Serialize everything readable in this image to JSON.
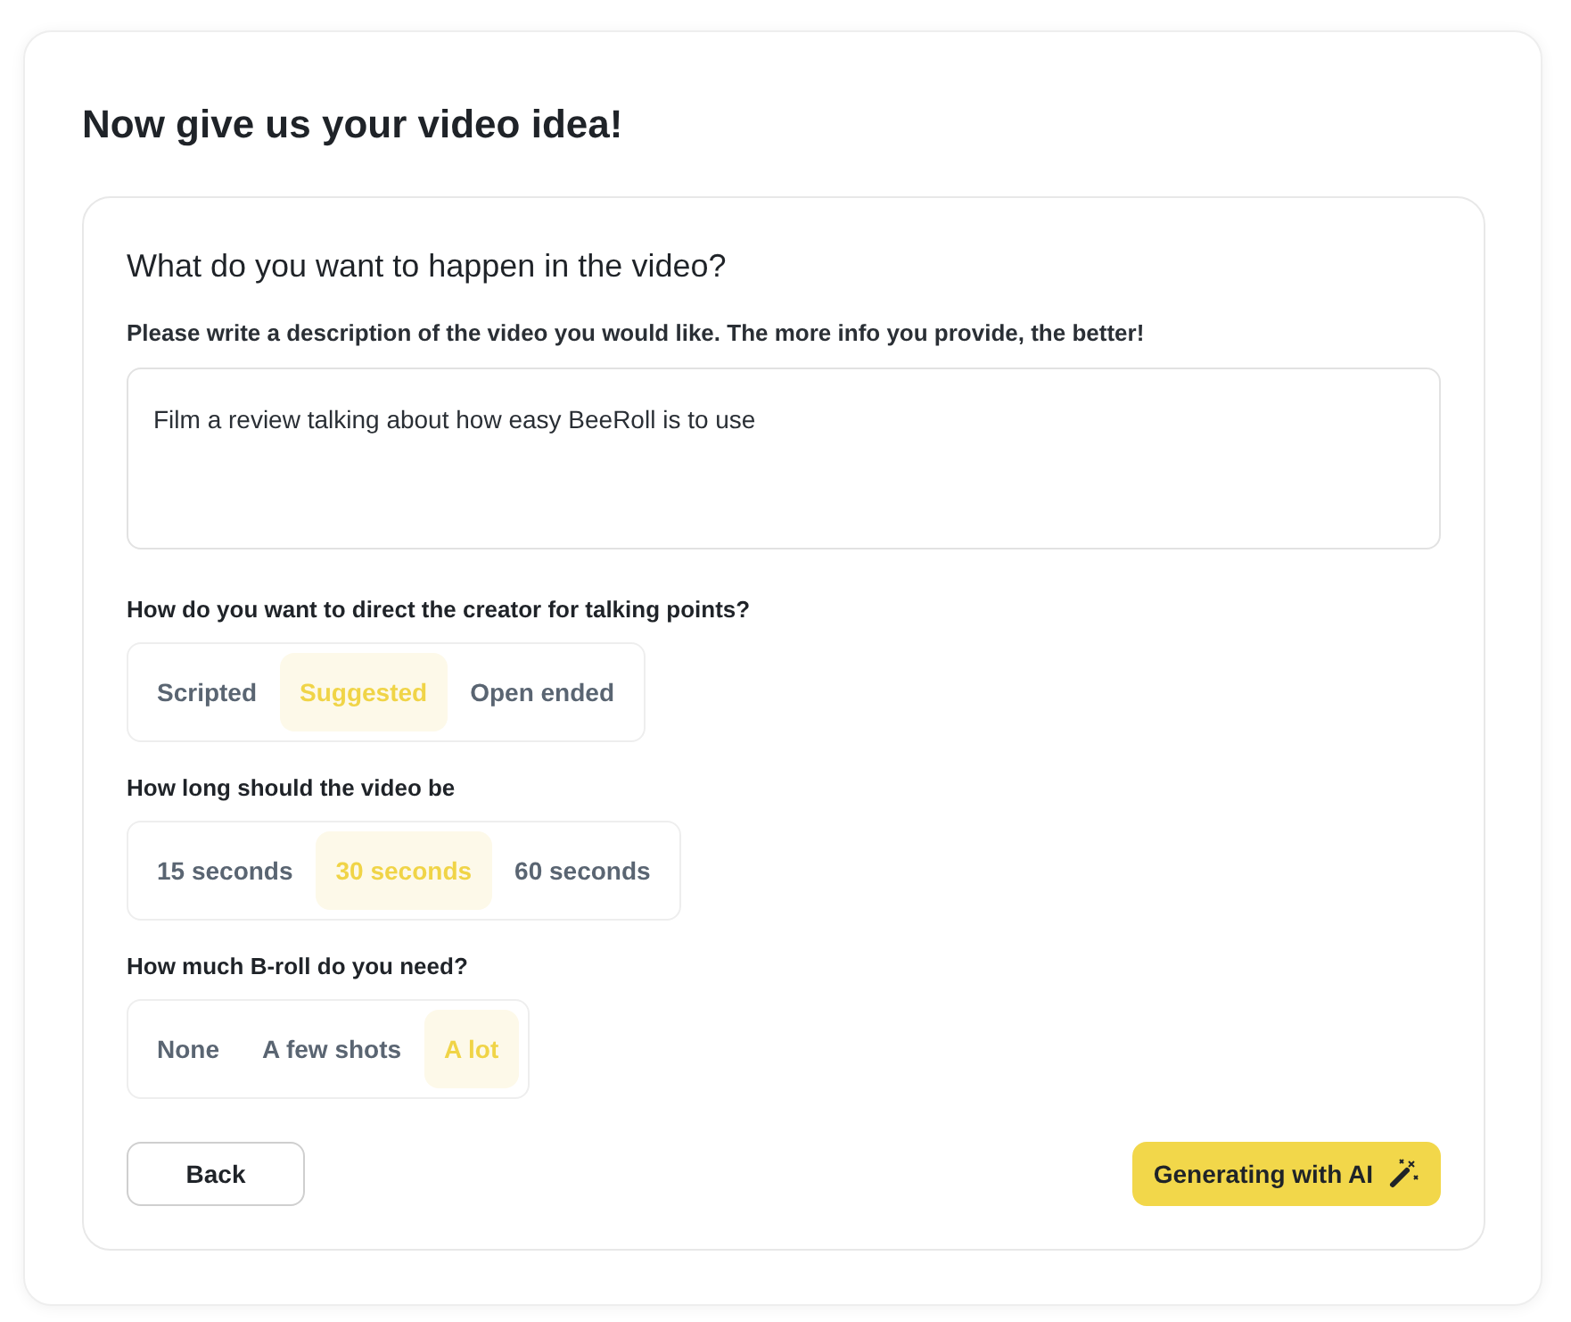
{
  "title": "Now give us your video idea!",
  "section": {
    "heading": "What do you want to happen in the video?",
    "description_label": "Please write a description of the video you would like. The more info you provide, the better!",
    "description_value": "Film a review talking about how easy BeeRoll is to use",
    "questions": [
      {
        "label": "How do you want to direct the creator for talking points?",
        "options": [
          {
            "label": "Scripted",
            "selected": false
          },
          {
            "label": "Suggested",
            "selected": true
          },
          {
            "label": "Open ended",
            "selected": false
          }
        ]
      },
      {
        "label": "How long should the video be",
        "options": [
          {
            "label": "15 seconds",
            "selected": false
          },
          {
            "label": "30 seconds",
            "selected": true
          },
          {
            "label": "60 seconds",
            "selected": false
          }
        ]
      },
      {
        "label": "How much B-roll do you need?",
        "options": [
          {
            "label": "None",
            "selected": false
          },
          {
            "label": "A few shots",
            "selected": false
          },
          {
            "label": "A lot",
            "selected": true
          }
        ]
      }
    ],
    "back_button": "Back",
    "generate_button": "Generating with AI"
  }
}
